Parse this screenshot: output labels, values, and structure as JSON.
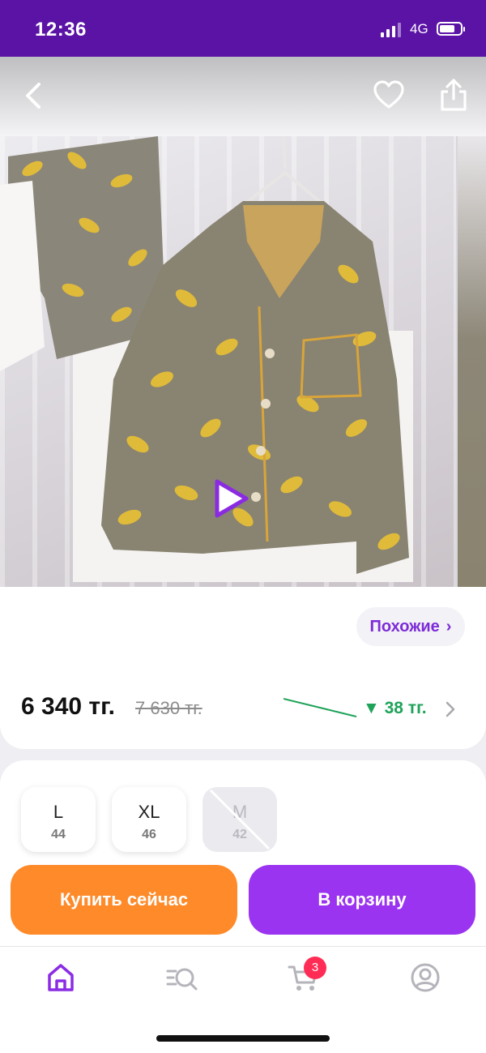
{
  "status_bar": {
    "time": "12:36",
    "network": "4G",
    "battery_level": 0.75
  },
  "header": {
    "back_icon": "chevron-left-icon",
    "favorite_icon": "heart-icon",
    "share_icon": "share-icon"
  },
  "gallery": {
    "play_icon": "play-icon"
  },
  "similar": {
    "label": "Похожие",
    "arrow": "›"
  },
  "pricing": {
    "price": "6 340 тг.",
    "old_price": "7 630 тг.",
    "drop_label": "▼ 38 тг."
  },
  "sizes": [
    {
      "label": "L",
      "value": "44",
      "available": true
    },
    {
      "label": "XL",
      "value": "46",
      "available": true
    },
    {
      "label": "M",
      "value": "42",
      "available": false
    }
  ],
  "actions": {
    "buy_now": "Купить сейчас",
    "add_to_cart": "В корзину"
  },
  "bottom_nav": {
    "items": [
      "home-icon",
      "catalog-search-icon",
      "cart-icon",
      "profile-icon"
    ],
    "cart_badge": "3"
  },
  "colors": {
    "status_bar": "#5b13a6",
    "accent_purple": "#9b34f0",
    "accent_orange": "#ff8a2a",
    "price_drop": "#1fa35a",
    "badge": "#ff2d55"
  }
}
